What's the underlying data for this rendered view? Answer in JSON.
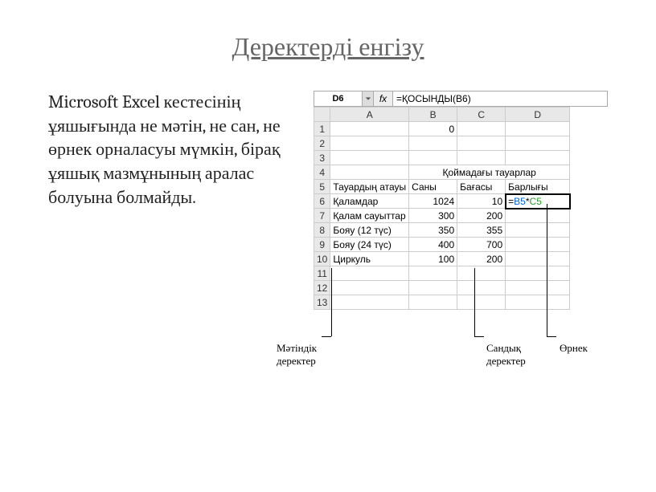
{
  "slide": {
    "title": "Деректерді енгізу",
    "body": "Microsoft Excel кестесінің ұяшығында не мәтін, не сан, не өрнек орналасуы мүмкін, бірақ ұяшық мазмұнының аралас болуына болмайды."
  },
  "excel": {
    "name_box": "D6",
    "fx_label": "fx",
    "formula": "=ҚОСЫНДЫ(B6)",
    "columns": [
      "A",
      "B",
      "C",
      "D"
    ],
    "row_count": 13,
    "cells": {
      "1": {
        "A": "",
        "B": "0",
        "C": "",
        "D": ""
      },
      "4": {
        "B_merge": "Қоймадағы тауарлар"
      },
      "5": {
        "A": "Тауардың атауы",
        "B": "Саны",
        "C": "Бағасы",
        "D": "Барлығы"
      },
      "6": {
        "A": "Қаламдар",
        "B": "1024",
        "C": "10",
        "D_formula_parts": [
          "=",
          "B5",
          "*",
          "C5"
        ]
      },
      "7": {
        "A": "Қалам сауыттар",
        "B": "300",
        "C": "200",
        "D": ""
      },
      "8": {
        "A": "Бояу (12 түс)",
        "B": "350",
        "C": "355",
        "D": ""
      },
      "9": {
        "A": "Бояу (24 түс)",
        "B": "400",
        "C": "700",
        "D": ""
      },
      "10": {
        "A": "Циркуль",
        "B": "100",
        "C": "200",
        "D": ""
      }
    }
  },
  "callouts": {
    "text_data": "Мәтіндік деректер",
    "numeric_data": "Сандық деректер",
    "expression": "Өрнек"
  }
}
